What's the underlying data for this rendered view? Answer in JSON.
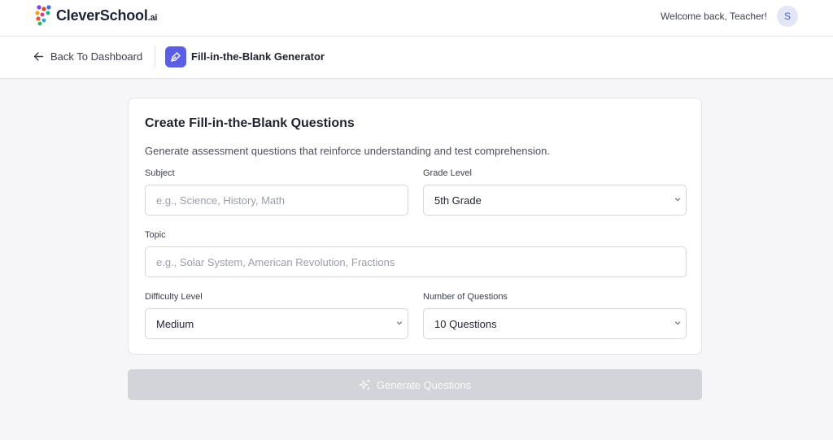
{
  "app": {
    "brand": "CleverSchool",
    "brand_suffix": ".ai",
    "welcome": "Welcome back, Teacher!",
    "avatar_initial": "S"
  },
  "nav": {
    "back_label": "Back To Dashboard",
    "tool_title": "Fill-in-the-Blank Generator"
  },
  "form": {
    "title": "Create Fill-in-the-Blank Questions",
    "description": "Generate assessment questions that reinforce understanding and test comprehension.",
    "subject": {
      "label": "Subject",
      "placeholder": "e.g., Science, History, Math",
      "value": ""
    },
    "grade": {
      "label": "Grade Level",
      "selected": "5th Grade"
    },
    "topic": {
      "label": "Topic",
      "placeholder": "e.g., Solar System, American Revolution, Fractions",
      "value": ""
    },
    "difficulty": {
      "label": "Difficulty Level",
      "selected": "Medium"
    },
    "num_questions": {
      "label": "Number of Questions",
      "selected": "10 Questions"
    }
  },
  "actions": {
    "generate_label": "Generate Questions",
    "generate_enabled": false
  },
  "colors": {
    "accent": "#5b5fe6",
    "avatar_bg": "#e3e6f7",
    "disabled_button": "#d3d4d9",
    "page_bg": "#f6f6f8"
  },
  "icons": [
    "logo-dots-icon",
    "arrow-left-icon",
    "pen-tool-icon",
    "chevron-down-icon",
    "sparkles-icon"
  ]
}
